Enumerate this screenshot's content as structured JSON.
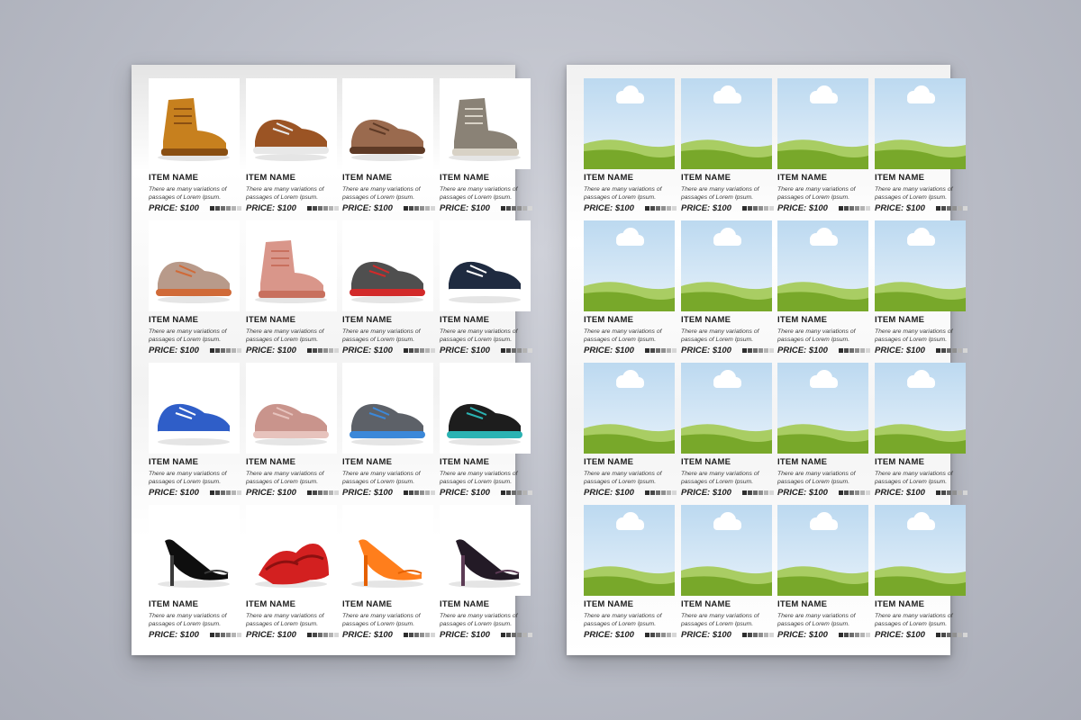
{
  "catalog": {
    "item_name": "ITEM NAME",
    "item_description": "There are many variations of passages of Lorem Ipsum.",
    "item_price": "PRICE: $100",
    "swatch_colors": [
      "#2d2d2d",
      "#4a4a4a",
      "#6d6d6d",
      "#8f8f8f",
      "#b3b3b3",
      "#d6d6d6"
    ]
  },
  "left_page": {
    "products": [
      {
        "image": "brown-work-boots",
        "colors": [
          "#c7801e",
          "#8a4f12"
        ]
      },
      {
        "image": "brown-leather-sneakers",
        "colors": [
          "#9b5424",
          "#e8e8e8"
        ]
      },
      {
        "image": "brown-suede-brogues",
        "colors": [
          "#9a6a4e",
          "#5e3a26"
        ]
      },
      {
        "image": "grey-desert-boots",
        "colors": [
          "#8a8276",
          "#d8d2c6"
        ]
      },
      {
        "image": "kids-sandals",
        "colors": [
          "#b89a8a",
          "#d06a38"
        ]
      },
      {
        "image": "pink-toddler-boots",
        "colors": [
          "#d9968a",
          "#c8705e"
        ]
      },
      {
        "image": "patterned-kids-shoes",
        "colors": [
          "#4f4f4f",
          "#d22a2a"
        ]
      },
      {
        "image": "navy-boat-shoes",
        "colors": [
          "#1f2b40",
          "#ffffff"
        ]
      },
      {
        "image": "blue-suede-sneakers",
        "colors": [
          "#2f5ec8",
          "#ffffff"
        ]
      },
      {
        "image": "pink-chunky-sneakers",
        "colors": [
          "#c9948c",
          "#e7c3bd"
        ]
      },
      {
        "image": "grey-running-shoes",
        "colors": [
          "#5d6168",
          "#3b88d9"
        ]
      },
      {
        "image": "black-hiking-shoes",
        "colors": [
          "#1d1d1d",
          "#2bb3b3"
        ]
      },
      {
        "image": "black-stiletto-heel",
        "colors": [
          "#0e0e0e",
          "#3a3a3a"
        ]
      },
      {
        "image": "red-ballet-flats",
        "colors": [
          "#d32020",
          "#8c1010"
        ]
      },
      {
        "image": "orange-pumps",
        "colors": [
          "#ff7e1c",
          "#e56000"
        ]
      },
      {
        "image": "black-platform-heels",
        "colors": [
          "#231a26",
          "#5c3b55"
        ]
      }
    ]
  },
  "right_page": {
    "placeholders": 16,
    "placeholder_image": "image-placeholder-landscape",
    "sky_color": "#bcd9f0",
    "grass_color": "#78a82a"
  }
}
